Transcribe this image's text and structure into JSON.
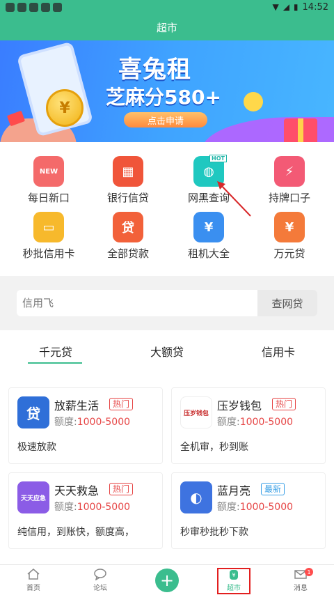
{
  "status_bar": {
    "time": "14:52"
  },
  "header": {
    "title": "超市"
  },
  "banner": {
    "brand": "喜兔租",
    "slogan": "芝麻分580+",
    "apply": "点击申请",
    "coin": "¥"
  },
  "categories": [
    {
      "label": "每日新口",
      "icon": "new-icon",
      "glyph": "NEW"
    },
    {
      "label": "银行信贷",
      "icon": "bank-building-icon",
      "glyph": "▦"
    },
    {
      "label": "网黑查询",
      "icon": "magnifier-icon",
      "glyph": "◍",
      "hot": "HOT"
    },
    {
      "label": "持牌口子",
      "icon": "lightning-icon",
      "glyph": "⚡"
    },
    {
      "label": "秒批信用卡",
      "icon": "credit-card-icon",
      "glyph": "▭"
    },
    {
      "label": "全部贷款",
      "icon": "loan-seal-icon",
      "glyph": "贷"
    },
    {
      "label": "租机大全",
      "icon": "phone-rent-icon",
      "glyph": "¥"
    },
    {
      "label": "万元贷",
      "icon": "money-bag-icon",
      "glyph": "¥"
    }
  ],
  "search": {
    "placeholder": "信用飞",
    "button": "查网贷"
  },
  "tabs": [
    "千元贷",
    "大额贷",
    "信用卡"
  ],
  "products": [
    {
      "name": "放薪生活",
      "tag": "热门",
      "quota_label": "额度:",
      "quota": "1000-5000",
      "desc": "极速放款",
      "logo_text": "贷"
    },
    {
      "name": "压岁钱包",
      "tag": "热门",
      "quota_label": "额度:",
      "quota": "1000-5000",
      "desc": "全机审，秒到账",
      "logo_text": "压岁钱包"
    },
    {
      "name": "天天救急",
      "tag": "热门",
      "quota_label": "额度:",
      "quota": "1000-5000",
      "desc": "纯信用，到账快，额度高，",
      "logo_text": "天天应急"
    },
    {
      "name": "蓝月亮",
      "tag": "最新",
      "quota_label": "额度:",
      "quota": "1000-5000",
      "desc": "秒审秒批秒下款",
      "logo_text": "◐"
    }
  ],
  "bottom_nav": [
    {
      "label": "首页",
      "icon": "home-icon"
    },
    {
      "label": "论坛",
      "icon": "chat-icon"
    },
    {
      "label": "+",
      "icon": "plus-icon"
    },
    {
      "label": "超市",
      "icon": "market-icon"
    },
    {
      "label": "消息",
      "icon": "mail-icon",
      "badge": "1"
    }
  ],
  "colors": {
    "primary": "#3bbd8e",
    "hot": "#e64545",
    "new": "#3aa0e6"
  }
}
